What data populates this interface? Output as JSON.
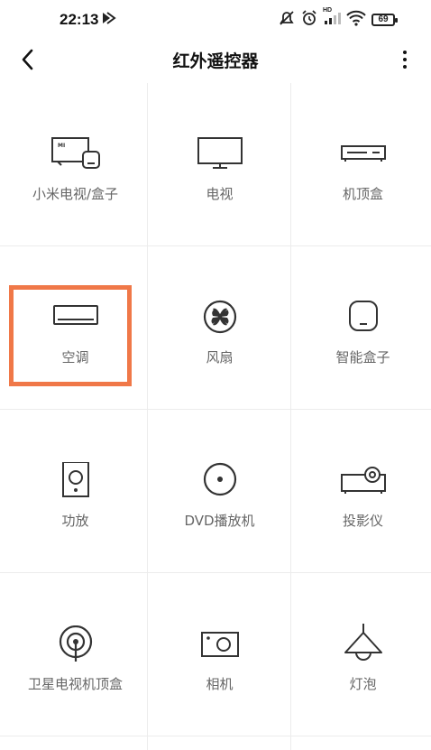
{
  "status_bar": {
    "time": "22:13",
    "battery": "69",
    "hd_label": "HD"
  },
  "header": {
    "title": "红外遥控器",
    "back_icon": "chevron-left-icon",
    "more_icon": "more-vertical-icon"
  },
  "devices": [
    {
      "id": "mi-tv-box",
      "label": "小米电视/盒子",
      "icon": "mi-tv-box-icon",
      "selected": false
    },
    {
      "id": "tv",
      "label": "电视",
      "icon": "tv-icon",
      "selected": false
    },
    {
      "id": "set-top-box",
      "label": "机顶盒",
      "icon": "set-top-box-icon",
      "selected": false
    },
    {
      "id": "air-conditioner",
      "label": "空调",
      "icon": "air-conditioner-icon",
      "selected": true
    },
    {
      "id": "fan",
      "label": "风扇",
      "icon": "fan-icon",
      "selected": false
    },
    {
      "id": "smart-box",
      "label": "智能盒子",
      "icon": "smart-box-icon",
      "selected": false
    },
    {
      "id": "amplifier",
      "label": "功放",
      "icon": "speaker-icon",
      "selected": false
    },
    {
      "id": "dvd-player",
      "label": "DVD播放机",
      "icon": "disc-icon",
      "selected": false
    },
    {
      "id": "projector",
      "label": "投影仪",
      "icon": "projector-icon",
      "selected": false
    },
    {
      "id": "satellite-box",
      "label": "卫星电视机顶盒",
      "icon": "satellite-icon",
      "selected": false
    },
    {
      "id": "camera",
      "label": "相机",
      "icon": "camera-icon",
      "selected": false
    },
    {
      "id": "lamp",
      "label": "灯泡",
      "icon": "lamp-icon",
      "selected": false
    }
  ],
  "colors": {
    "highlight": "#f07848",
    "icon_stroke": "#333333",
    "label_text": "#666666",
    "divider": "#ececec"
  }
}
